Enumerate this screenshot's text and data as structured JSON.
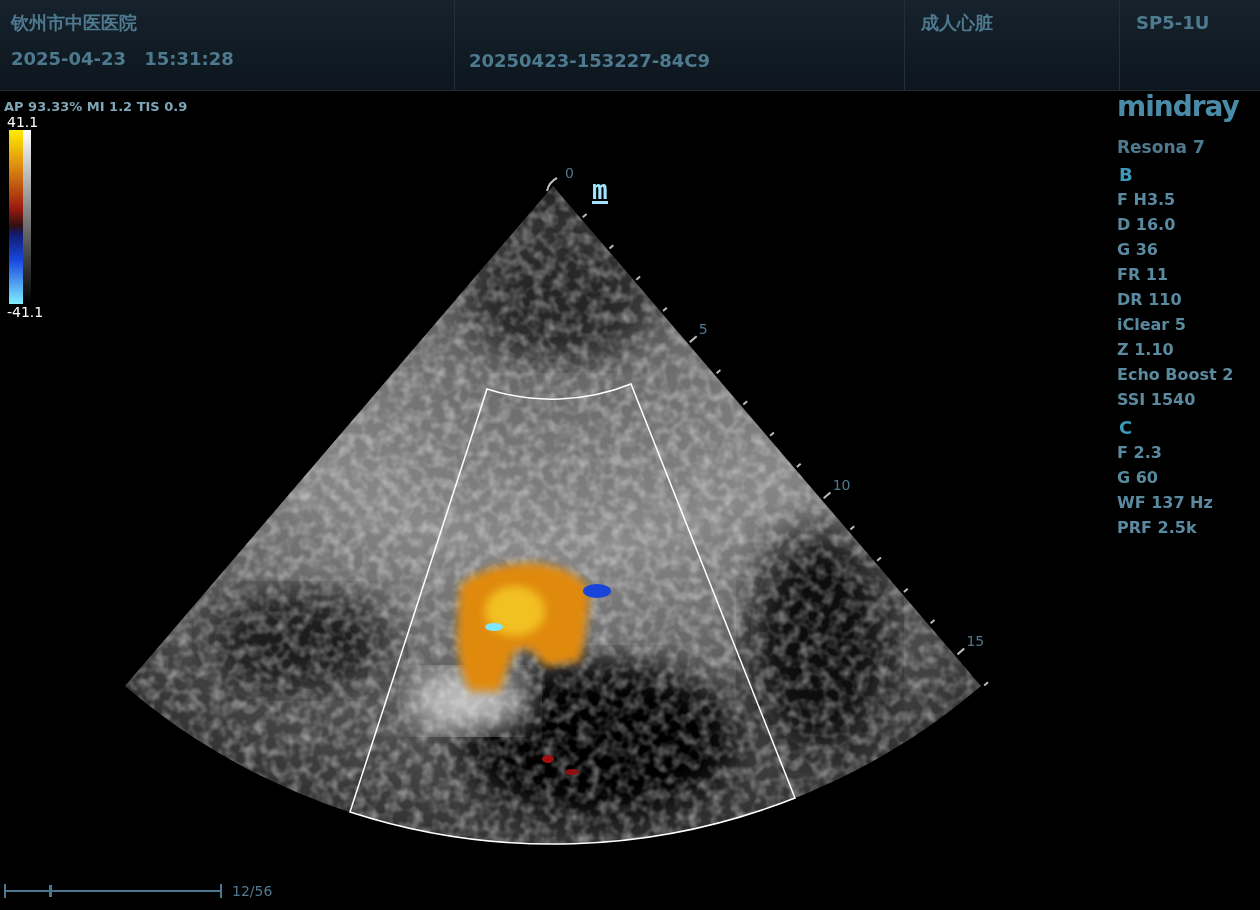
{
  "header": {
    "hospital": "钦州市中医医院",
    "date": "2025-04-23",
    "time": "15:31:28",
    "exam_id": "20250423-153227-84C9",
    "preset": "成人心脏",
    "probe": "SP5-1U"
  },
  "acoustic_output": "AP 93.33%  MI 1.2 TIS 0.9",
  "color_scale": {
    "max": "41.1",
    "min": "-41.1"
  },
  "image": {
    "orientation_marker": "m",
    "depth_labels": [
      "0",
      "5",
      "10",
      "15"
    ]
  },
  "side_panel": {
    "brand": "mindray",
    "model": "Resona 7",
    "sections": [
      {
        "title": "B",
        "params": [
          "F H3.5",
          "D 16.0",
          "G 36",
          "FR 11",
          "DR 110",
          "iClear 5",
          "Z 1.10",
          "Echo Boost 2",
          "SSI 1540"
        ]
      },
      {
        "title": "C",
        "params": [
          "F 2.3",
          "G 60",
          "WF 137 Hz",
          "PRF 2.5k"
        ]
      }
    ]
  },
  "cine": {
    "level": 0.2,
    "counter": "12/56"
  }
}
